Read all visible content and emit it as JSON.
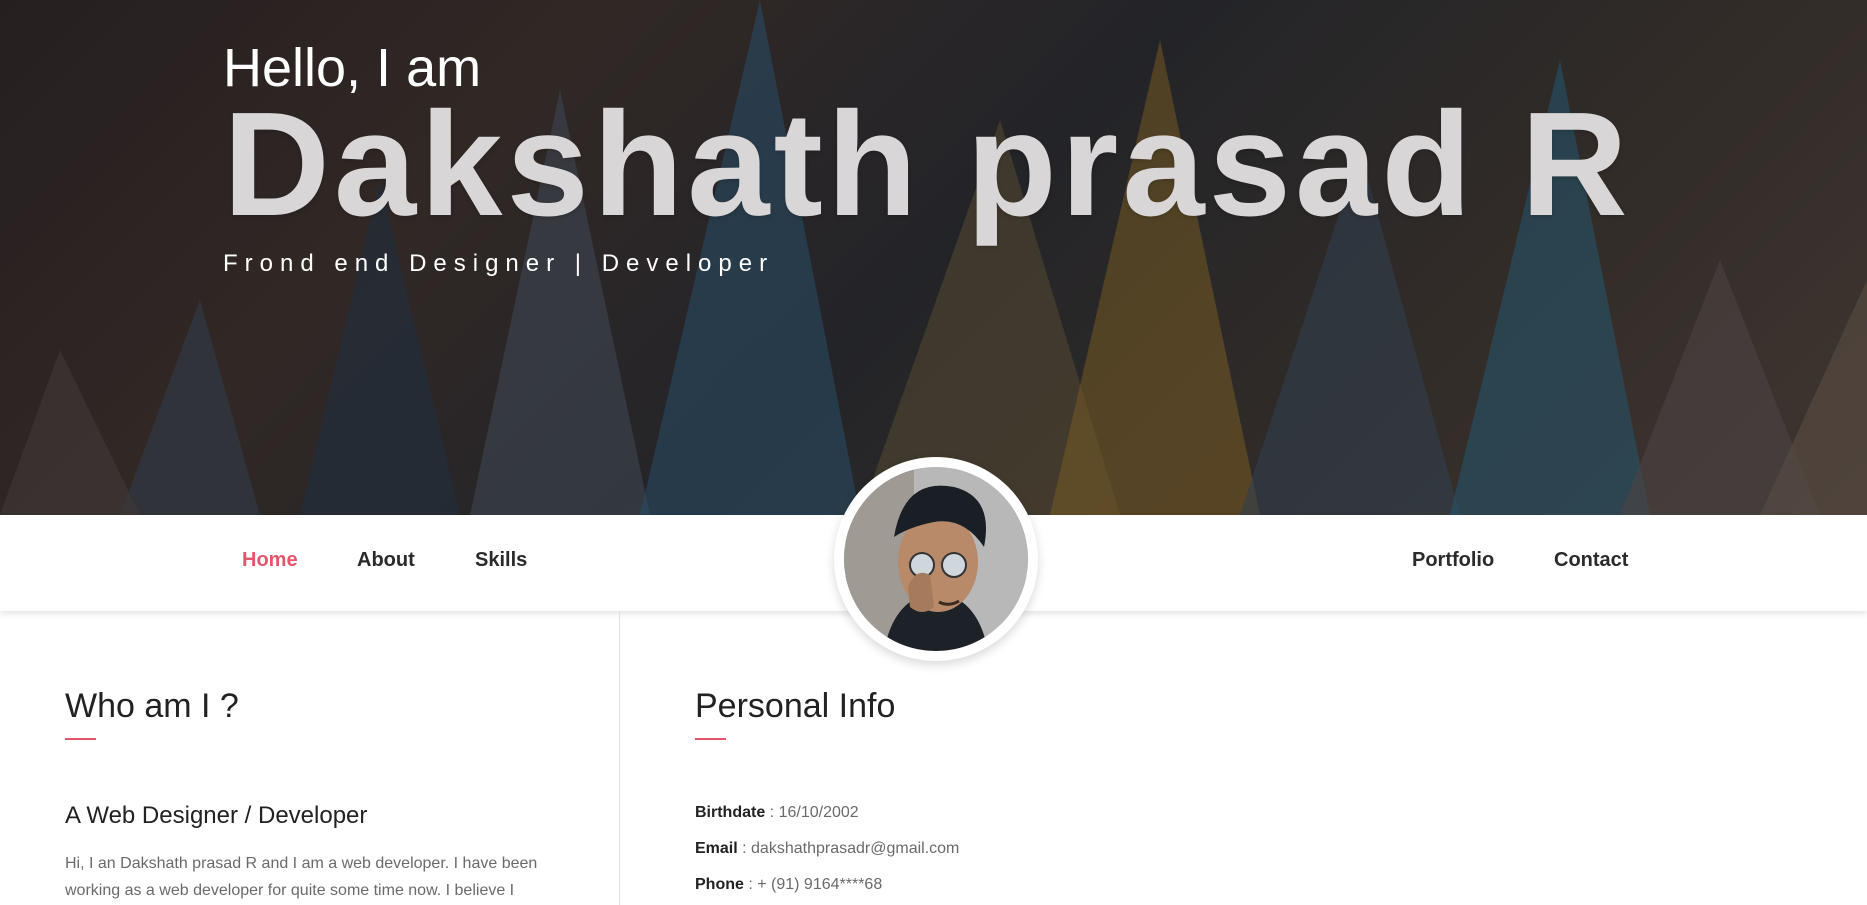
{
  "hero": {
    "greeting": "Hello, I am",
    "name": "Dakshath prasad R",
    "tagline": "Frond end Designer | Developer"
  },
  "nav": {
    "left": [
      "Home",
      "About",
      "Skills"
    ],
    "right": [
      "Portfolio",
      "Contact"
    ],
    "active": "Home"
  },
  "about": {
    "title": "Who am I ?",
    "subtitle": "A Web Designer / Developer",
    "text": "Hi, I an Dakshath prasad R and I am a web developer. I have been working as a web developer for quite some time now. I believe I"
  },
  "personal_info": {
    "title": "Personal Info",
    "birthdate_label": "Birthdate",
    "birthdate": "16/10/2002",
    "email_label": "Email",
    "email": "dakshathprasadr@gmail.com",
    "phone_label": "Phone",
    "phone": "+ (91) 9164****68"
  },
  "colors": {
    "accent": "#e6566b",
    "text_dark": "#222222",
    "text_muted": "#6a6a6a"
  },
  "icons": {
    "profile": "avatar"
  }
}
